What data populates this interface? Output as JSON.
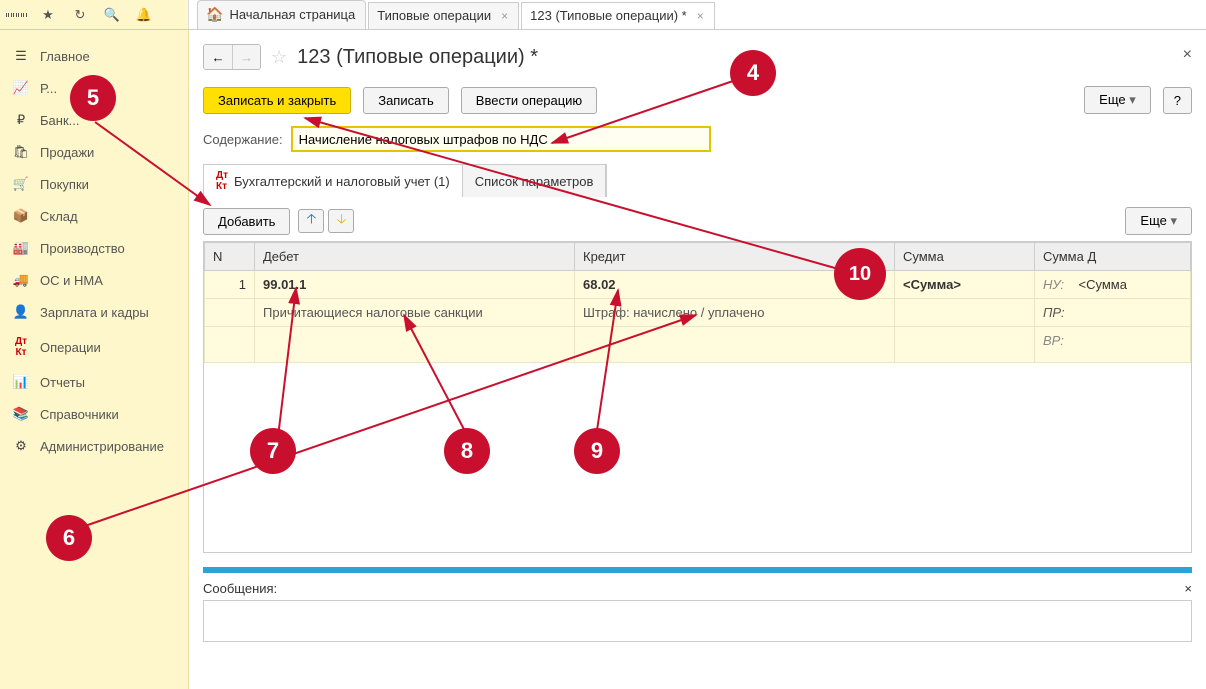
{
  "tabs": {
    "home": "Начальная страница",
    "t1": "Типовые операции",
    "t2": "123 (Типовые операции) *"
  },
  "sidebar": [
    {
      "icon": "☰",
      "label": "Главное"
    },
    {
      "icon": "📈",
      "label": "Р..."
    },
    {
      "icon": "₽",
      "label": "Банк..."
    },
    {
      "icon": "🛍",
      "label": "Продажи"
    },
    {
      "icon": "🛒",
      "label": "Покупки"
    },
    {
      "icon": "📦",
      "label": "Склад"
    },
    {
      "icon": "🏭",
      "label": "Производство"
    },
    {
      "icon": "🚚",
      "label": "ОС и НМА"
    },
    {
      "icon": "👤",
      "label": "Зарплата и кадры"
    },
    {
      "icon": "Дт",
      "label": "Операции"
    },
    {
      "icon": "📊",
      "label": "Отчеты"
    },
    {
      "icon": "📚",
      "label": "Справочники"
    },
    {
      "icon": "⚙",
      "label": "Администрирование"
    }
  ],
  "page_title": "123 (Типовые операции) *",
  "buttons": {
    "save_close": "Записать и закрыть",
    "save": "Записать",
    "enter_op": "Ввести операцию",
    "more": "Еще",
    "help": "?",
    "add": "Добавить"
  },
  "content_label": "Содержание:",
  "content_value": "Начисление налоговых штрафов по НДС",
  "inner_tabs": {
    "acct": "Бухгалтерский и налоговый учет (1)",
    "params": "Список параметров"
  },
  "table": {
    "cols": {
      "n": "N",
      "debit": "Дебет",
      "credit": "Кредит",
      "sum": "Сумма",
      "sumd": "Сумма Д"
    },
    "row": {
      "n": "1",
      "debit_acc": "99.01.1",
      "debit_desc": "Причитающиеся налоговые санкции",
      "credit_acc": "68.02",
      "credit_desc": "Штраф: начислено / уплачено",
      "sum": "<Сумма>",
      "sumd": "<Сумма",
      "nu": "НУ:",
      "pr": "ПР:",
      "vr": "ВР:"
    }
  },
  "messages_label": "Сообщения:",
  "markers": {
    "m4": "4",
    "m5": "5",
    "m6": "6",
    "m7": "7",
    "m8": "8",
    "m9": "9",
    "m10": "10"
  }
}
